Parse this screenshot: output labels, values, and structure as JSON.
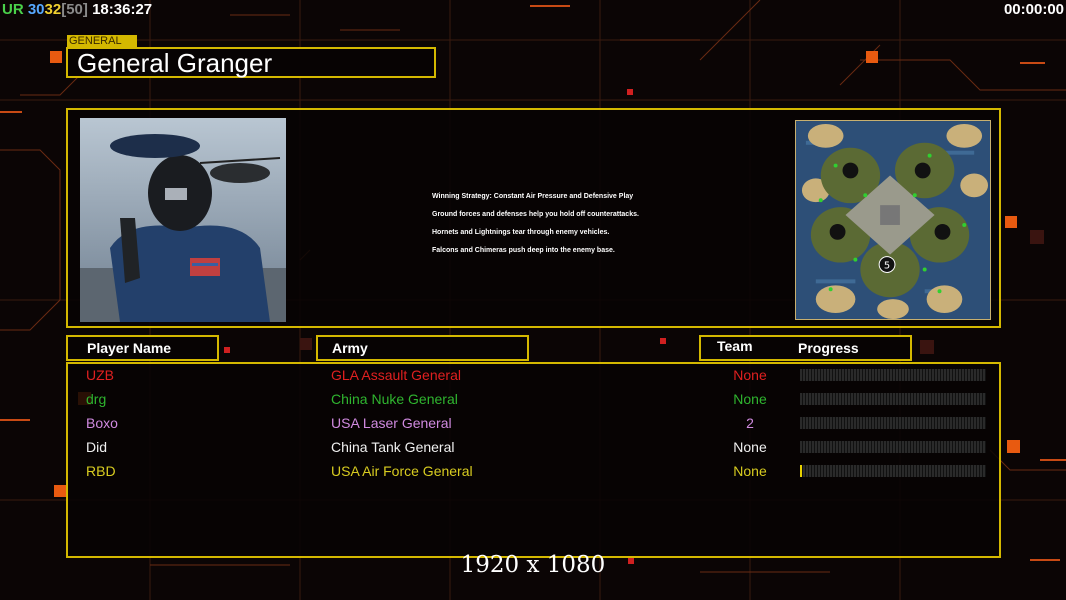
{
  "hud": {
    "ur_label": "UR",
    "val_a": "30",
    "val_b": "32",
    "val_c": "[50]",
    "clock": "18:36:27",
    "timer": "00:00:00"
  },
  "general": {
    "tag": "GENERAL",
    "name": "General Granger",
    "portrait_icon": "air-force-general-portrait",
    "minimap_icon": "island-map-preview"
  },
  "strategy": [
    "Winning Strategy: Constant Air Pressure and Defensive Play",
    "Ground forces and defenses help you hold off counterattacks.",
    "Hornets and Lightnings tear through enemy vehicles.",
    "Falcons and Chimeras push deep into the enemy base."
  ],
  "columns": {
    "player": "Player Name",
    "army": "Army",
    "team": "Team",
    "progress": "Progress"
  },
  "players": [
    {
      "name": "UZB",
      "army": "GLA Assault General",
      "team": "None",
      "color": "#e02020",
      "progress": 0
    },
    {
      "name": "drg",
      "army": "China Nuke General",
      "team": "None",
      "color": "#2fb52f",
      "progress": 0
    },
    {
      "name": "Boxo",
      "army": "USA Laser General",
      "team": "2",
      "color": "#d08ae0",
      "progress": 0
    },
    {
      "name": "Did",
      "army": "China Tank General",
      "team": "None",
      "color": "#f0f0f0",
      "progress": 0
    },
    {
      "name": "RBD",
      "army": "USA Air Force General",
      "team": "None",
      "color": "#d8cc20",
      "progress": 0.01
    }
  ],
  "resolution": "1920 x 1080",
  "colors": {
    "accent": "#d4b800",
    "background": "#0b0505",
    "deco_orange": "#e85a10"
  }
}
